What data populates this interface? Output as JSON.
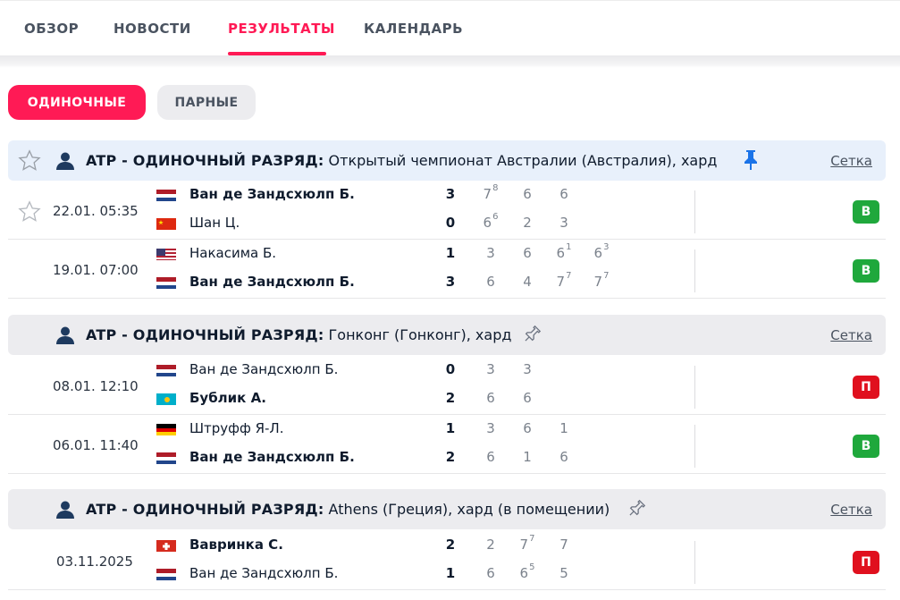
{
  "tabs": [
    {
      "label": "ОБЗОР",
      "active": false
    },
    {
      "label": "НОВОСТИ",
      "active": false
    },
    {
      "label": "РЕЗУЛЬТАТЫ",
      "active": true
    },
    {
      "label": "КАЛЕНДАРЬ",
      "active": false
    }
  ],
  "filters": {
    "singles": "ОДИНОЧНЫЕ",
    "doubles": "ПАРНЫЕ"
  },
  "colors": {
    "accent": "#ff1a55",
    "win": "#1fa83c",
    "loss": "#e0101e"
  },
  "tournaments": [
    {
      "category": "ATP - ОДИНОЧНЫЙ РАЗРЯД:",
      "name": "Открытый чемпионат Австралии (Австралия), хард",
      "pinned": true,
      "link": "Сетка",
      "matches": [
        {
          "date": "22.01. 05:35",
          "result": "В",
          "players": [
            {
              "name": "Ван де Зандсхюлп Б.",
              "flag": "netherlands",
              "winner": true,
              "score": "3",
              "sets": [
                [
                  "7",
                  "8"
                ],
                [
                  "6",
                  ""
                ],
                [
                  "6",
                  ""
                ]
              ]
            },
            {
              "name": "Шан Ц.",
              "flag": "china",
              "winner": false,
              "score": "0",
              "sets": [
                [
                  "6",
                  "6"
                ],
                [
                  "2",
                  ""
                ],
                [
                  "3",
                  ""
                ]
              ]
            }
          ]
        },
        {
          "date": "19.01. 07:00",
          "result": "В",
          "players": [
            {
              "name": "Накасима Б.",
              "flag": "usa",
              "winner": false,
              "score": "1",
              "sets": [
                [
                  "3",
                  ""
                ],
                [
                  "6",
                  ""
                ],
                [
                  "6",
                  "1"
                ],
                [
                  "6",
                  "3"
                ]
              ]
            },
            {
              "name": "Ван де Зандсхюлп Б.",
              "flag": "netherlands",
              "winner": true,
              "score": "3",
              "sets": [
                [
                  "6",
                  ""
                ],
                [
                  "4",
                  ""
                ],
                [
                  "7",
                  "7"
                ],
                [
                  "7",
                  "7"
                ]
              ]
            }
          ]
        }
      ]
    },
    {
      "category": "ATP - ОДИНОЧНЫЙ РАЗРЯД:",
      "name": "Гонконг (Гонконг), хард",
      "pinned": false,
      "link": "Сетка",
      "matches": [
        {
          "date": "08.01. 12:10",
          "result": "П",
          "players": [
            {
              "name": "Ван де Зандсхюлп Б.",
              "flag": "netherlands",
              "winner": false,
              "score": "0",
              "sets": [
                [
                  "3",
                  ""
                ],
                [
                  "3",
                  ""
                ]
              ]
            },
            {
              "name": "Бублик А.",
              "flag": "kazakhstan",
              "winner": true,
              "score": "2",
              "sets": [
                [
                  "6",
                  ""
                ],
                [
                  "6",
                  ""
                ]
              ]
            }
          ]
        },
        {
          "date": "06.01. 11:40",
          "result": "В",
          "players": [
            {
              "name": "Штруфф Я-Л.",
              "flag": "germany",
              "winner": false,
              "score": "1",
              "sets": [
                [
                  "3",
                  ""
                ],
                [
                  "6",
                  ""
                ],
                [
                  "1",
                  ""
                ]
              ]
            },
            {
              "name": "Ван де Зандсхюлп Б.",
              "flag": "netherlands",
              "winner": true,
              "score": "2",
              "sets": [
                [
                  "6",
                  ""
                ],
                [
                  "1",
                  ""
                ],
                [
                  "6",
                  ""
                ]
              ]
            }
          ]
        }
      ]
    },
    {
      "category": "ATP - ОДИНОЧНЫЙ РАЗРЯД:",
      "name": "Athens (Греция), хард (в помещении)",
      "pinned": false,
      "link": "Сетка",
      "matches": [
        {
          "date": "03.11.2025",
          "result": "П",
          "players": [
            {
              "name": "Вавринка С.",
              "flag": "switzerland",
              "winner": true,
              "score": "2",
              "sets": [
                [
                  "2",
                  ""
                ],
                [
                  "7",
                  "7"
                ],
                [
                  "7",
                  ""
                ]
              ]
            },
            {
              "name": "Ван де Зандсхюлп Б.",
              "flag": "netherlands",
              "winner": false,
              "score": "1",
              "sets": [
                [
                  "6",
                  ""
                ],
                [
                  "6",
                  "5"
                ],
                [
                  "5",
                  ""
                ]
              ]
            }
          ]
        }
      ]
    }
  ]
}
